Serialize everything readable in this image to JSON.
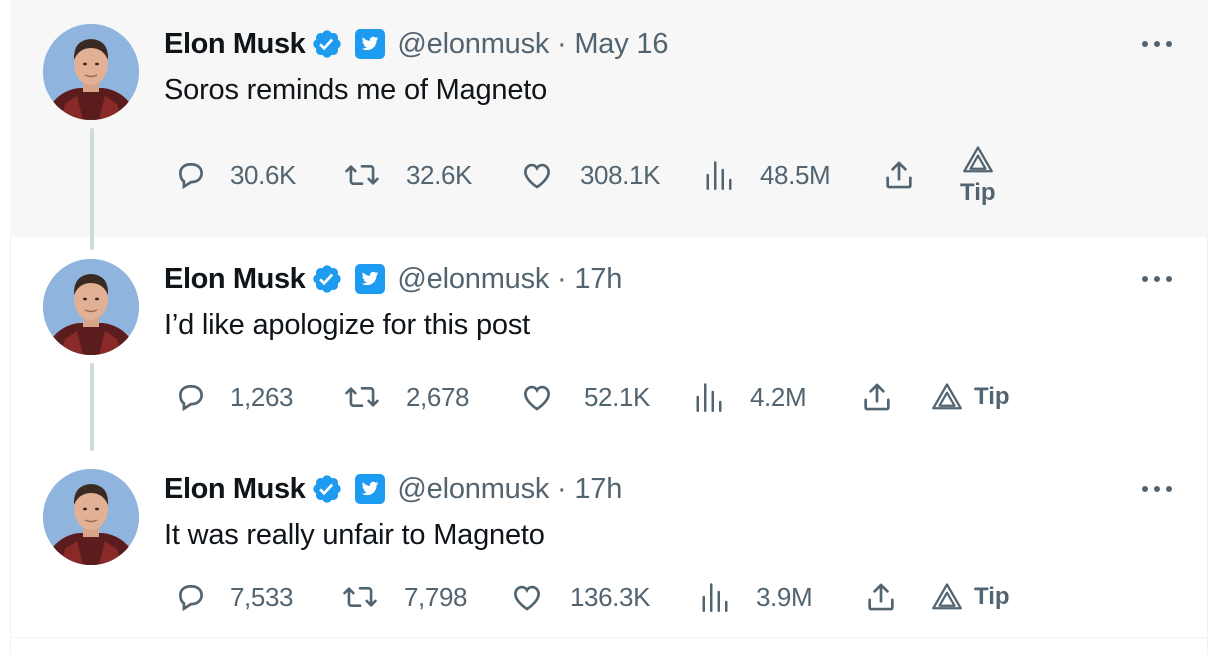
{
  "colors": {
    "primary_text": "#0f1419",
    "secondary_text": "#536471",
    "verified_blue": "#1d9bf0",
    "highlight_bg": "#f7f7f7",
    "thread_line": "#cfd9de"
  },
  "tweets": [
    {
      "author_name": "Elon Musk",
      "handle_time": "@elonmusk · May 16",
      "text": "Soros reminds me of Magneto",
      "replies": "30.6K",
      "retweets": "32.6K",
      "likes": "308.1K",
      "views": "48.5M",
      "tip_label": "Tip"
    },
    {
      "author_name": "Elon Musk",
      "handle_time": "@elonmusk · 17h",
      "text": "I’d like apologize for this post",
      "replies": "1,263",
      "retweets": "2,678",
      "likes": "52.1K",
      "views": "4.2M",
      "tip_label": "Tip"
    },
    {
      "author_name": "Elon Musk",
      "handle_time": "@elonmusk · 17h",
      "text": "It was really unfair to Magneto",
      "replies": "7,533",
      "retweets": "7,798",
      "likes": "136.3K",
      "views": "3.9M",
      "tip_label": "Tip"
    }
  ],
  "icons": [
    "avatar-photo",
    "verified-badge-icon",
    "twitter-bird-badge-icon",
    "more-dots-icon",
    "reply-icon",
    "retweet-icon",
    "like-icon",
    "views-icon",
    "share-icon",
    "tip-icon"
  ]
}
